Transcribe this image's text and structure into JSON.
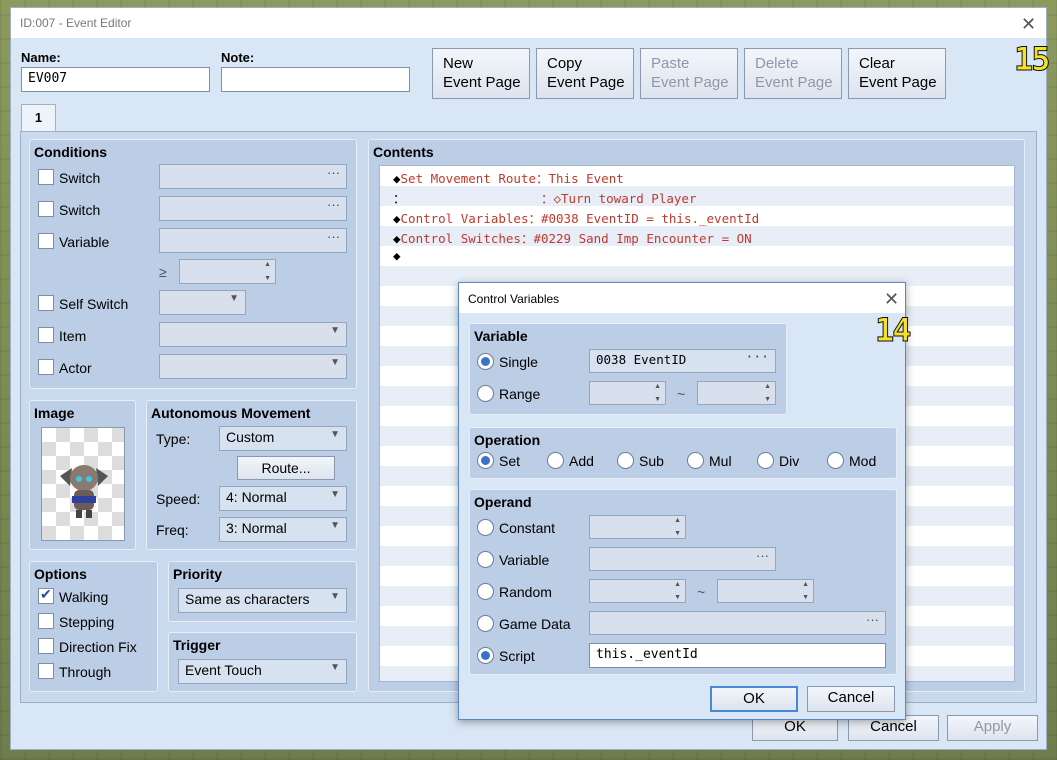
{
  "window": {
    "title": "ID:007 - Event Editor",
    "badge": "15"
  },
  "name": {
    "label": "Name:",
    "value": "EV007"
  },
  "note": {
    "label": "Note:",
    "value": ""
  },
  "page_buttons": [
    {
      "line1": "New",
      "line2": "Event Page",
      "enabled": true
    },
    {
      "line1": "Copy",
      "line2": "Event Page",
      "enabled": true
    },
    {
      "line1": "Paste",
      "line2": "Event Page",
      "enabled": false
    },
    {
      "line1": "Delete",
      "line2": "Event Page",
      "enabled": false
    },
    {
      "line1": "Clear",
      "line2": "Event Page",
      "enabled": true
    }
  ],
  "tab": "1",
  "conditions": {
    "title": "Conditions",
    "switch1": "Switch",
    "switch2": "Switch",
    "variable": "Variable",
    "ge": "≥",
    "self_switch": "Self Switch",
    "item": "Item",
    "actor": "Actor",
    "dots": "···"
  },
  "image": {
    "title": "Image"
  },
  "autonomous": {
    "title": "Autonomous Movement",
    "type_label": "Type:",
    "type_value": "Custom",
    "route_button": "Route...",
    "speed_label": "Speed:",
    "speed_value": "4: Normal",
    "freq_label": "Freq:",
    "freq_value": "3: Normal"
  },
  "options": {
    "title": "Options",
    "items": [
      {
        "label": "Walking",
        "checked": true
      },
      {
        "label": "Stepping",
        "checked": false
      },
      {
        "label": "Direction Fix",
        "checked": false
      },
      {
        "label": "Through",
        "checked": false
      }
    ]
  },
  "priority": {
    "title": "Priority",
    "value": "Same as characters"
  },
  "trigger": {
    "title": "Trigger",
    "value": "Event Touch"
  },
  "contents": {
    "title": "Contents",
    "lines": [
      {
        "marker": "◆",
        "text": "Set Movement Route：This Event"
      },
      {
        "marker": "：",
        "text": "                  ：◇Turn toward Player"
      },
      {
        "marker": "◆",
        "text": "Control Variables：#0038 EventID = this._eventId"
      },
      {
        "marker": "◆",
        "text": "Control Switches：#0229 Sand Imp Encounter = ON"
      },
      {
        "marker": "◆",
        "text": ""
      }
    ]
  },
  "footer": {
    "ok": "OK",
    "cancel": "Cancel",
    "apply": "Apply"
  },
  "dialog": {
    "title": "Control Variables",
    "badge": "14",
    "variable": {
      "title": "Variable",
      "single": "Single",
      "single_value": "0038 EventID",
      "range": "Range",
      "tilde": "~"
    },
    "operation": {
      "title": "Operation",
      "items": [
        "Set",
        "Add",
        "Sub",
        "Mul",
        "Div",
        "Mod"
      ],
      "selected": "Set"
    },
    "operand": {
      "title": "Operand",
      "constant": "Constant",
      "variable": "Variable",
      "random": "Random",
      "game_data": "Game Data",
      "script": "Script",
      "script_value": "this._eventId",
      "tilde": "~"
    },
    "ok": "OK",
    "cancel": "Cancel"
  }
}
